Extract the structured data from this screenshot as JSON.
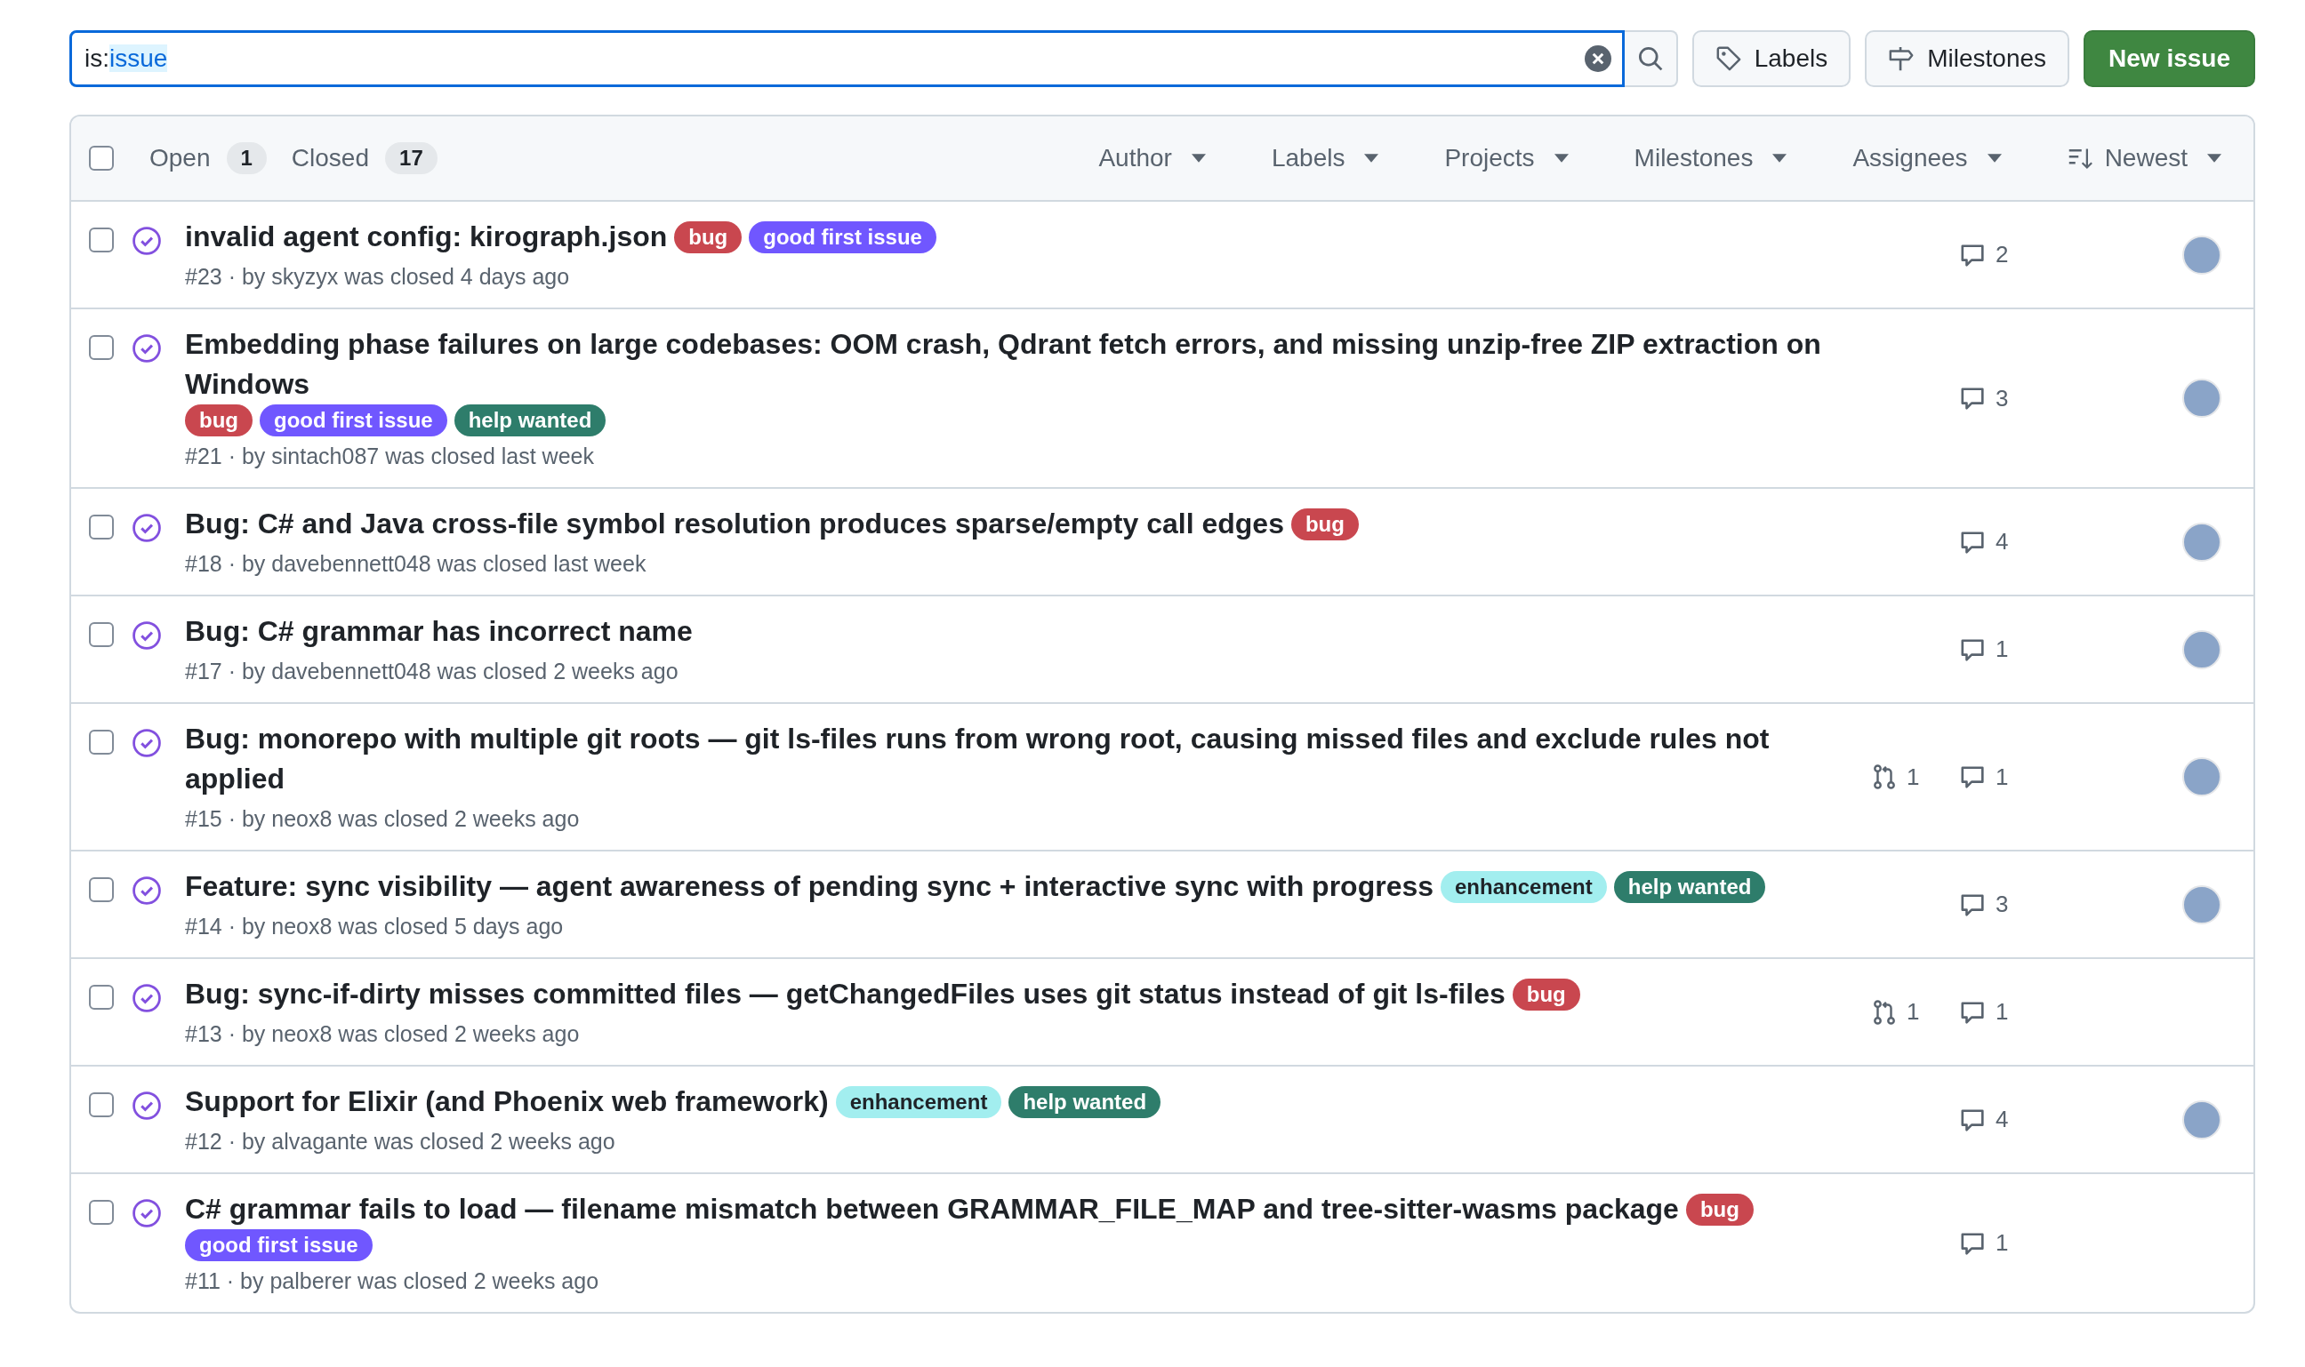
{
  "search": {
    "prefix": "is:",
    "value": "issue"
  },
  "toolbar_buttons": [
    {
      "kind": "labels",
      "label": "Labels"
    },
    {
      "kind": "milestones",
      "label": "Milestones"
    }
  ],
  "new_issue_button": "New issue",
  "header": {
    "select_all": {
      "checked": false
    },
    "tabs": [
      {
        "label": "Open",
        "count": "1"
      },
      {
        "label": "Closed",
        "count": "17"
      }
    ],
    "filters": [
      {
        "label": "Author",
        "kind": "menu"
      },
      {
        "label": "Labels",
        "kind": "menu"
      },
      {
        "label": "Projects",
        "kind": "menu"
      },
      {
        "label": "Milestones",
        "kind": "menu"
      },
      {
        "label": "Assignees",
        "kind": "menu"
      },
      {
        "label": "Newest",
        "kind": "sort"
      }
    ]
  },
  "issues": [
    {
      "title": "invalid agent config: kirograph.json",
      "labels": [
        {
          "name": "bug",
          "color": "#c9474f"
        },
        {
          "name": "good first issue",
          "color": "#7057ff"
        }
      ],
      "meta": "#23 · by skyzyx was closed 4 days ago",
      "checked": false,
      "comments": "2",
      "assigned": true
    },
    {
      "title": "Embedding phase failures on large codebases: OOM crash, Qdrant fetch errors, and missing unzip-free ZIP extraction on Windows",
      "labels": [
        {
          "name": "bug",
          "color": "#c9474f"
        },
        {
          "name": "good first issue",
          "color": "#7057ff"
        },
        {
          "name": "help wanted",
          "color": "#2e7d6b"
        }
      ],
      "meta": "#21 · by sintach087 was closed last week",
      "checked": false,
      "comments": "3",
      "assigned": true
    },
    {
      "title": "Bug: C# and Java cross-file symbol resolution produces sparse/empty call edges",
      "labels": [
        {
          "name": "bug",
          "color": "#c9474f"
        }
      ],
      "meta": "#18 · by davebennett048 was closed last week",
      "checked": false,
      "comments": "4",
      "assigned": true
    },
    {
      "title": "Bug: C# grammar has incorrect name",
      "meta": "#17 · by davebennett048 was closed 2 weeks ago",
      "checked": false,
      "comments": "1",
      "assigned": true
    },
    {
      "title": "Bug: monorepo with multiple git roots — git ls-files runs from wrong root, causing missed files and exclude rules not applied",
      "meta": "#15 · by neox8 was closed 2 weeks ago",
      "checked": false,
      "linked_prs": "1",
      "comments": "1",
      "assigned": true
    },
    {
      "title": "Feature: sync visibility — agent awareness of pending sync + interactive sync with progress",
      "labels": [
        {
          "name": "enhancement",
          "color": "#a2eeef"
        },
        {
          "name": "help wanted",
          "color": "#2e7d6b"
        }
      ],
      "meta": "#14 · by neox8 was closed 5 days ago",
      "checked": false,
      "comments": "3",
      "assigned": true
    },
    {
      "title": "Bug: sync-if-dirty misses committed files — getChangedFiles uses git status instead of git ls-files",
      "labels": [
        {
          "name": "bug",
          "color": "#c9474f"
        }
      ],
      "meta": "#13 · by neox8 was closed 2 weeks ago",
      "checked": false,
      "linked_prs": "1",
      "comments": "1",
      "assigned": false
    },
    {
      "title": "Support for Elixir (and Phoenix web framework)",
      "labels": [
        {
          "name": "enhancement",
          "color": "#a2eeef"
        },
        {
          "name": "help wanted",
          "color": "#2e7d6b"
        }
      ],
      "meta": "#12 · by alvagante was closed 2 weeks ago",
      "checked": false,
      "comments": "4",
      "assigned": true
    },
    {
      "title": "C# grammar fails to load — filename mismatch between GRAMMAR_FILE_MAP and tree-sitter-wasms package",
      "labels": [
        {
          "name": "bug",
          "color": "#c9474f"
        },
        {
          "name": "good first issue",
          "color": "#7057ff"
        }
      ],
      "meta": "#11 · by palberer was closed 2 weeks ago",
      "checked": false,
      "comments": "1",
      "assigned": false
    }
  ]
}
